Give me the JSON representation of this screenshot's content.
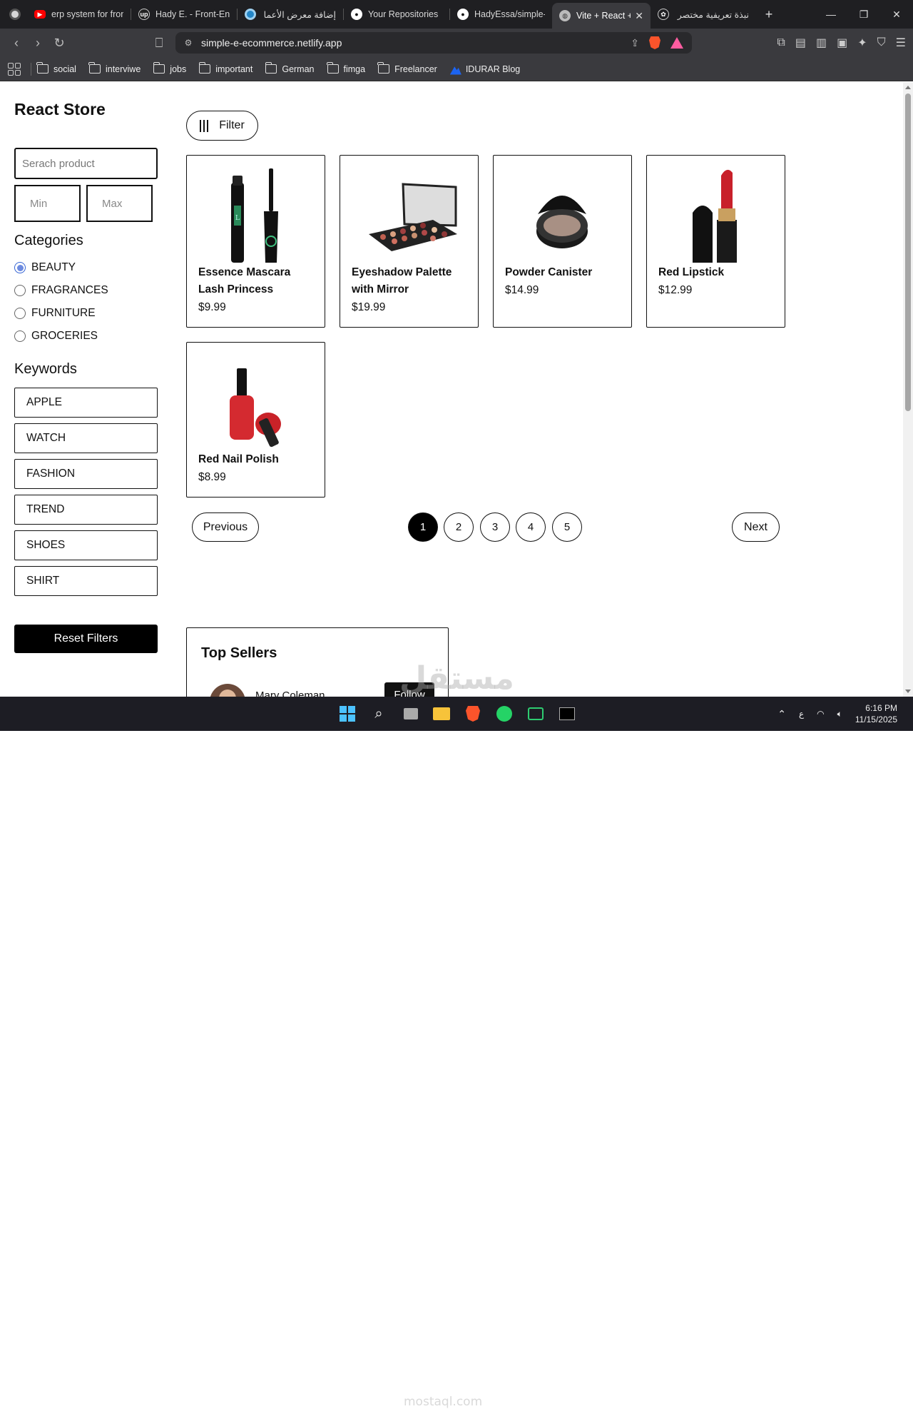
{
  "browser": {
    "tabs": [
      {
        "label": "erp system for fron",
        "icon": "youtube-icon",
        "color": "#ff0000"
      },
      {
        "label": "Hady E. - Front-En",
        "icon": "upwork-icon",
        "color": "#444444"
      },
      {
        "label": "إضافة معرض الأعما",
        "icon": "mostaql-icon",
        "color": "#2386c8"
      },
      {
        "label": "Your Repositories",
        "icon": "github-icon",
        "color": "#ffffff"
      },
      {
        "label": "HadyEssa/simple-E",
        "icon": "github-icon",
        "color": "#ffffff"
      },
      {
        "label": "Vite + React +",
        "icon": "globe-icon",
        "color": "#dddddd"
      },
      {
        "label": "نبذة تعريفية مختصر",
        "icon": "chatgpt-icon",
        "color": "#dddddd"
      }
    ],
    "url": "simple-e-ecommerce.netlify.app",
    "bookmarks": [
      "social",
      "interviwe",
      "jobs",
      "important",
      "German",
      "fimga",
      "Freelancer",
      "IDURAR Blog"
    ]
  },
  "sidebar": {
    "title": "React Store",
    "search_placeholder": "Serach product",
    "min_placeholder": "Min",
    "max_placeholder": "Max",
    "categories_title": "Categories",
    "categories": [
      "BEAUTY",
      "FRAGRANCES",
      "FURNITURE",
      "GROCERIES"
    ],
    "selected_category": "BEAUTY",
    "keywords_title": "Keywords",
    "keywords": [
      "APPLE",
      "WATCH",
      "FASHION",
      "TREND",
      "SHOES",
      "SHIRT"
    ],
    "reset_label": "Reset Filters"
  },
  "main": {
    "filter_label": "Filter",
    "products": [
      {
        "name": "Essence Mascara Lash Princess",
        "price": "$9.99"
      },
      {
        "name": "Eyeshadow Palette with Mirror",
        "price": "$19.99"
      },
      {
        "name": "Powder Canister",
        "price": "$14.99"
      },
      {
        "name": "Red Lipstick",
        "price": "$12.99"
      },
      {
        "name": "Red Nail Polish",
        "price": "$8.99"
      }
    ],
    "pagination": {
      "previous": "Previous",
      "next": "Next",
      "pages": [
        "1",
        "2",
        "3",
        "4",
        "5"
      ],
      "current": "1"
    },
    "top_sellers": {
      "title": "Top Sellers",
      "seller_name": "Mary Coleman",
      "follow_label": "Follow"
    }
  },
  "taskbar": {
    "time": "6:16 PM",
    "date": "11/15/2025",
    "lang": "ع"
  },
  "watermark": {
    "arabic": "مستقل",
    "latin": "mostaql.com"
  }
}
